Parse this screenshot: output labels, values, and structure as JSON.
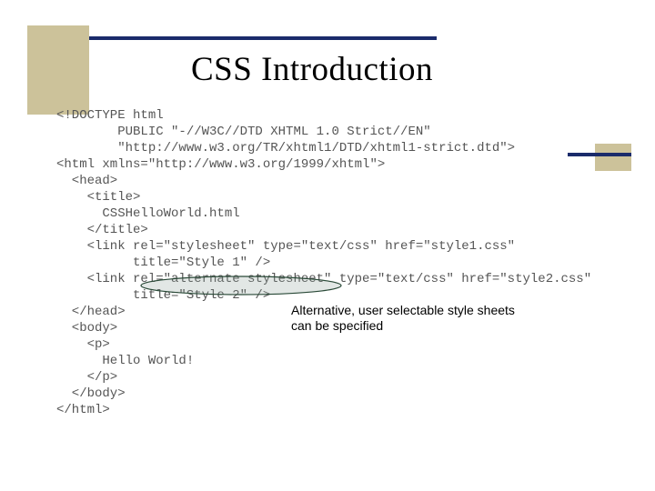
{
  "title": "CSS Introduction",
  "code": {
    "l1": "<!DOCTYPE html",
    "l2": "        PUBLIC \"-//W3C//DTD XHTML 1.0 Strict//EN\"",
    "l3": "        \"http://www.w3.org/TR/xhtml1/DTD/xhtml1-strict.dtd\">",
    "l4": "<html xmlns=\"http://www.w3.org/1999/xhtml\">",
    "l5": "  <head>",
    "l6": "    <title>",
    "l7": "      CSSHelloWorld.html",
    "l8": "    </title>",
    "l9": "    <link rel=\"stylesheet\" type=\"text/css\" href=\"style1.css\"",
    "l10": "          title=\"Style 1\" />",
    "l11": "    <link rel=\"alternate stylesheet\" type=\"text/css\" href=\"style2.css\"",
    "l12": "          title=\"Style 2\" />",
    "l13": "  </head>",
    "l14": "  <body>",
    "l15": "    <p>",
    "l16": "      Hello World!",
    "l17": "    </p>",
    "l18": "  </body>",
    "l19": "</html>"
  },
  "annotation": {
    "line1": "Alternative, user selectable style sheets",
    "line2": "can be specified"
  }
}
